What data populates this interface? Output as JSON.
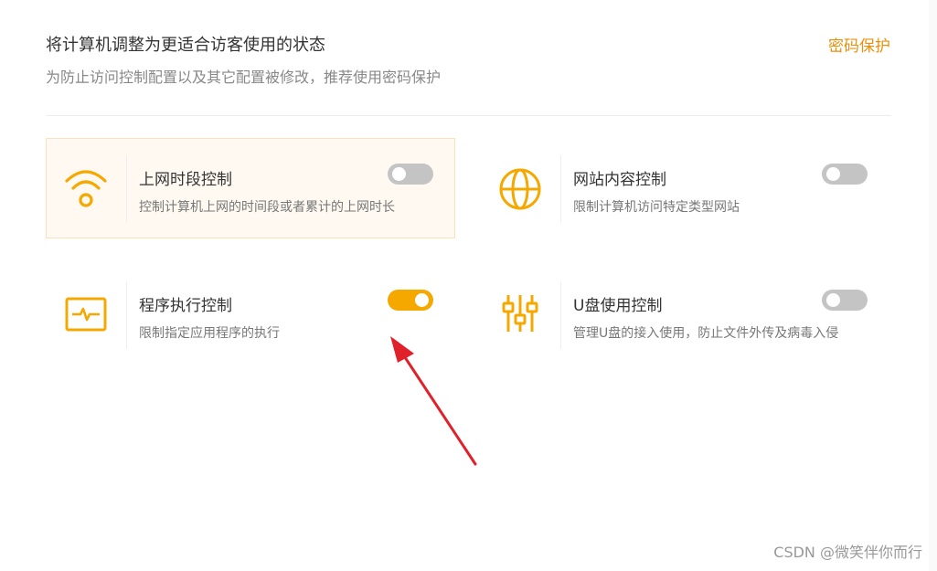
{
  "header": {
    "title": "将计算机调整为更适合访客使用的状态",
    "subtitle": "为防止访问控制配置以及其它配置被修改，推荐使用密码保护",
    "password_link": "密码保护"
  },
  "colors": {
    "accent": "#f5a800",
    "link": "#e8900c",
    "arrow": "#e0212a",
    "toggle_off": "#c4c4c4"
  },
  "controls": [
    {
      "icon": "wifi-icon",
      "title": "上网时段控制",
      "desc": "控制计算机上网的时间段或者累计的上网时长",
      "enabled": false,
      "highlighted": true
    },
    {
      "icon": "globe-icon",
      "title": "网站内容控制",
      "desc": "限制计算机访问特定类型网站",
      "enabled": false,
      "highlighted": false
    },
    {
      "icon": "program-monitor-icon",
      "title": "程序执行控制",
      "desc": "限制指定应用程序的执行",
      "enabled": true,
      "highlighted": false
    },
    {
      "icon": "usb-sliders-icon",
      "title": "U盘使用控制",
      "desc": "管理U盘的接入使用，防止文件外传及病毒入侵",
      "enabled": false,
      "highlighted": false
    }
  ],
  "watermark": "CSDN @微笑伴你而行"
}
